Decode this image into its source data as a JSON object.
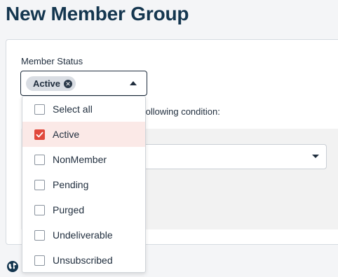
{
  "page": {
    "title": "New Member Group"
  },
  "member_status": {
    "label": "Member Status",
    "selected_chip": "Active",
    "options": [
      {
        "label": "Select all",
        "checked": false
      },
      {
        "label": "Active",
        "checked": true
      },
      {
        "label": "NonMember",
        "checked": false
      },
      {
        "label": "Pending",
        "checked": false
      },
      {
        "label": "Purged",
        "checked": false
      },
      {
        "label": "Undeliverable",
        "checked": false
      },
      {
        "label": "Unsubscribed",
        "checked": false
      }
    ]
  },
  "condition": {
    "text_visible": "following condition:"
  },
  "colors": {
    "title": "#14364f",
    "accent_checked": "#e0483b",
    "selected_row_bg": "#fbe9e7",
    "chip_bg": "#d9dde3"
  },
  "icons": {
    "footer": "globe-icon",
    "chip_remove": "close-circle-icon",
    "dropdown": "caret-icon"
  }
}
